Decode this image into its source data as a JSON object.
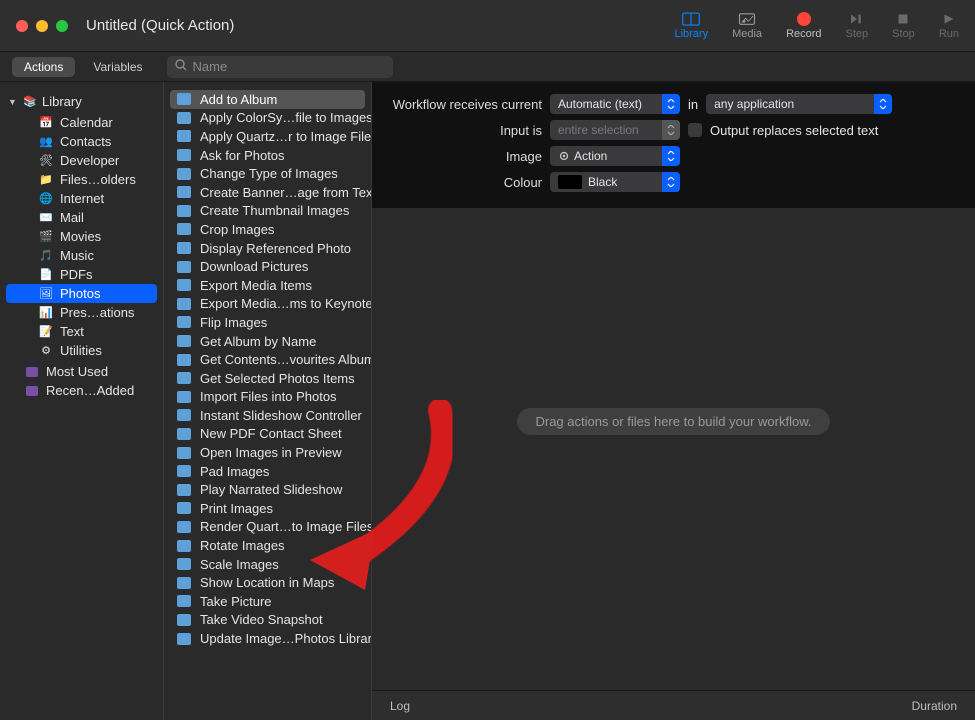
{
  "window": {
    "title": "Untitled (Quick Action)"
  },
  "toolbar": {
    "library": "Library",
    "media": "Media",
    "record": "Record",
    "step": "Step",
    "stop": "Stop",
    "run": "Run"
  },
  "tabs": {
    "actions": "Actions",
    "variables": "Variables",
    "search_placeholder": "Name"
  },
  "sidebar": {
    "library_label": "Library",
    "items": [
      {
        "label": "Calendar",
        "icon_bg": "#ffffff",
        "glyph": "📅"
      },
      {
        "label": "Contacts",
        "icon_bg": "#8e8e93",
        "glyph": "👥"
      },
      {
        "label": "Developer",
        "icon_bg": "#555",
        "glyph": "🛠"
      },
      {
        "label": "Files…olders",
        "icon_bg": "#0a84ff",
        "glyph": "📁"
      },
      {
        "label": "Internet",
        "icon_bg": "#666",
        "glyph": "🌐"
      },
      {
        "label": "Mail",
        "icon_bg": "#1e90ff",
        "glyph": "✉️"
      },
      {
        "label": "Movies",
        "icon_bg": "#555",
        "glyph": "🎬"
      },
      {
        "label": "Music",
        "icon_bg": "#ff2d55",
        "glyph": "🎵"
      },
      {
        "label": "PDFs",
        "icon_bg": "#eee",
        "glyph": "📄"
      },
      {
        "label": "Photos",
        "icon_bg": "#0a84ff",
        "glyph": "🖼",
        "selected": true
      },
      {
        "label": "Pres…ations",
        "icon_bg": "#ff9500",
        "glyph": "📊"
      },
      {
        "label": "Text",
        "icon_bg": "#ddd",
        "glyph": "📝"
      },
      {
        "label": "Utilities",
        "icon_bg": "#555",
        "glyph": "⚙"
      }
    ],
    "smart_items": [
      {
        "label": "Most Used",
        "glyph": "⬛"
      },
      {
        "label": "Recen…Added",
        "glyph": "⬛"
      }
    ]
  },
  "actions": {
    "items": [
      {
        "label": "Add to Album",
        "selected": true
      },
      {
        "label": "Apply ColorSy…file to Images"
      },
      {
        "label": "Apply Quartz…r to Image Files"
      },
      {
        "label": "Ask for Photos"
      },
      {
        "label": "Change Type of Images"
      },
      {
        "label": "Create Banner…age from Text"
      },
      {
        "label": "Create Thumbnail Images"
      },
      {
        "label": "Crop Images"
      },
      {
        "label": "Display Referenced Photo"
      },
      {
        "label": "Download Pictures"
      },
      {
        "label": "Export Media Items"
      },
      {
        "label": "Export Media…ms to Keynote"
      },
      {
        "label": "Flip Images"
      },
      {
        "label": "Get Album by Name"
      },
      {
        "label": "Get Contents…vourites Album"
      },
      {
        "label": "Get Selected Photos Items"
      },
      {
        "label": "Import Files into Photos"
      },
      {
        "label": "Instant Slideshow Controller"
      },
      {
        "label": "New PDF Contact Sheet"
      },
      {
        "label": "Open Images in Preview"
      },
      {
        "label": "Pad Images"
      },
      {
        "label": "Play Narrated Slideshow"
      },
      {
        "label": "Print Images"
      },
      {
        "label": "Render Quart…to Image Files"
      },
      {
        "label": "Rotate Images"
      },
      {
        "label": "Scale Images"
      },
      {
        "label": "Show Location in Maps"
      },
      {
        "label": "Take Picture"
      },
      {
        "label": "Take Video Snapshot"
      },
      {
        "label": "Update Image…Photos Library"
      }
    ]
  },
  "workflow_header": {
    "receives_label": "Workflow receives current",
    "receives_value": "Automatic (text)",
    "in_label": "in",
    "in_value": "any application",
    "input_is_label": "Input is",
    "input_is_value": "entire selection",
    "output_replaces_label": "Output replaces selected text",
    "image_label": "Image",
    "image_value": "Action",
    "colour_label": "Colour",
    "colour_value": "Black"
  },
  "workflow_body": {
    "drop_hint": "Drag actions or files here to build your workflow."
  },
  "footer": {
    "log": "Log",
    "duration": "Duration"
  }
}
